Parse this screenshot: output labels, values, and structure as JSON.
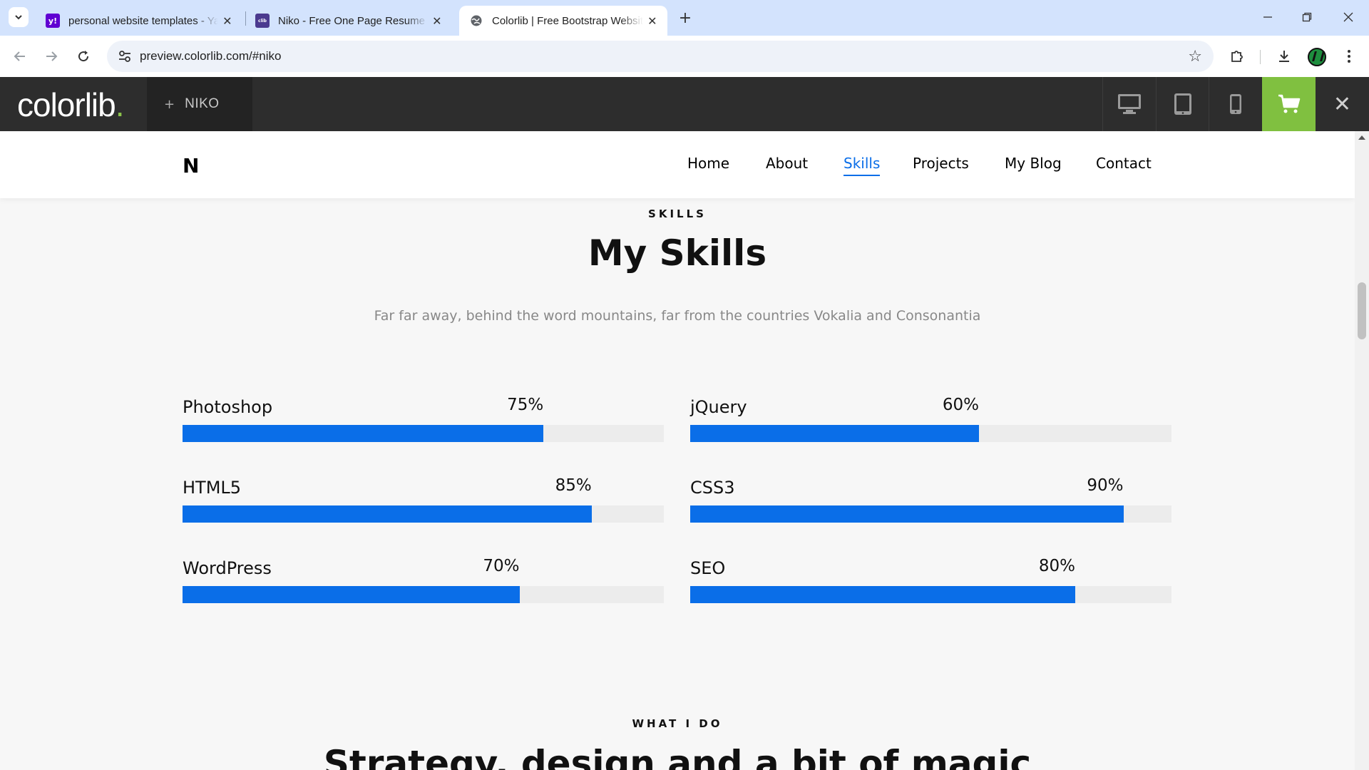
{
  "browser": {
    "tabs": [
      {
        "title": "personal website templates - Yahoo Search",
        "favicon": "yahoo-icon",
        "favicon_color": "#6001d2",
        "active": false
      },
      {
        "title": "Niko - Free One Page Resume Website Template",
        "favicon": "colorlib-icon",
        "favicon_color": "#4b3a8f",
        "active": false
      },
      {
        "title": "Colorlib | Free Bootstrap Website Templates",
        "favicon": "globe-icon",
        "favicon_color": "#5f6368",
        "active": true
      }
    ],
    "url": "preview.colorlib.com/#niko"
  },
  "preview_bar": {
    "logo_text": "colorlib",
    "logo_dot": ".",
    "theme_plus": "+",
    "theme_name": "NIKO",
    "devices": [
      "desktop-icon",
      "tablet-icon",
      "mobile-icon"
    ],
    "accent": "#80c040"
  },
  "site": {
    "brand": "N",
    "menu": [
      {
        "label": "Home",
        "active": false
      },
      {
        "label": "About",
        "active": false
      },
      {
        "label": "Skills",
        "active": true
      },
      {
        "label": "Projects",
        "active": false
      },
      {
        "label": "My Blog",
        "active": false
      },
      {
        "label": "Contact",
        "active": false
      }
    ],
    "accent": "#0a6ee8",
    "skills_section": {
      "eyebrow": "SKILLS",
      "title": "My Skills",
      "subtitle": "Far far away, behind the word mountains, far from the countries Vokalia and Consonantia",
      "skills": [
        {
          "name": "Photoshop",
          "percent_label": "75%",
          "percent": 75
        },
        {
          "name": "jQuery",
          "percent_label": "60%",
          "percent": 60
        },
        {
          "name": "HTML5",
          "percent_label": "85%",
          "percent": 85
        },
        {
          "name": "CSS3",
          "percent_label": "90%",
          "percent": 90
        },
        {
          "name": "WordPress",
          "percent_label": "70%",
          "percent": 70
        },
        {
          "name": "SEO",
          "percent_label": "80%",
          "percent": 80
        }
      ]
    },
    "next_section": {
      "eyebrow": "WHAT I DO",
      "title": "Strategy, design and a bit of magic"
    }
  }
}
